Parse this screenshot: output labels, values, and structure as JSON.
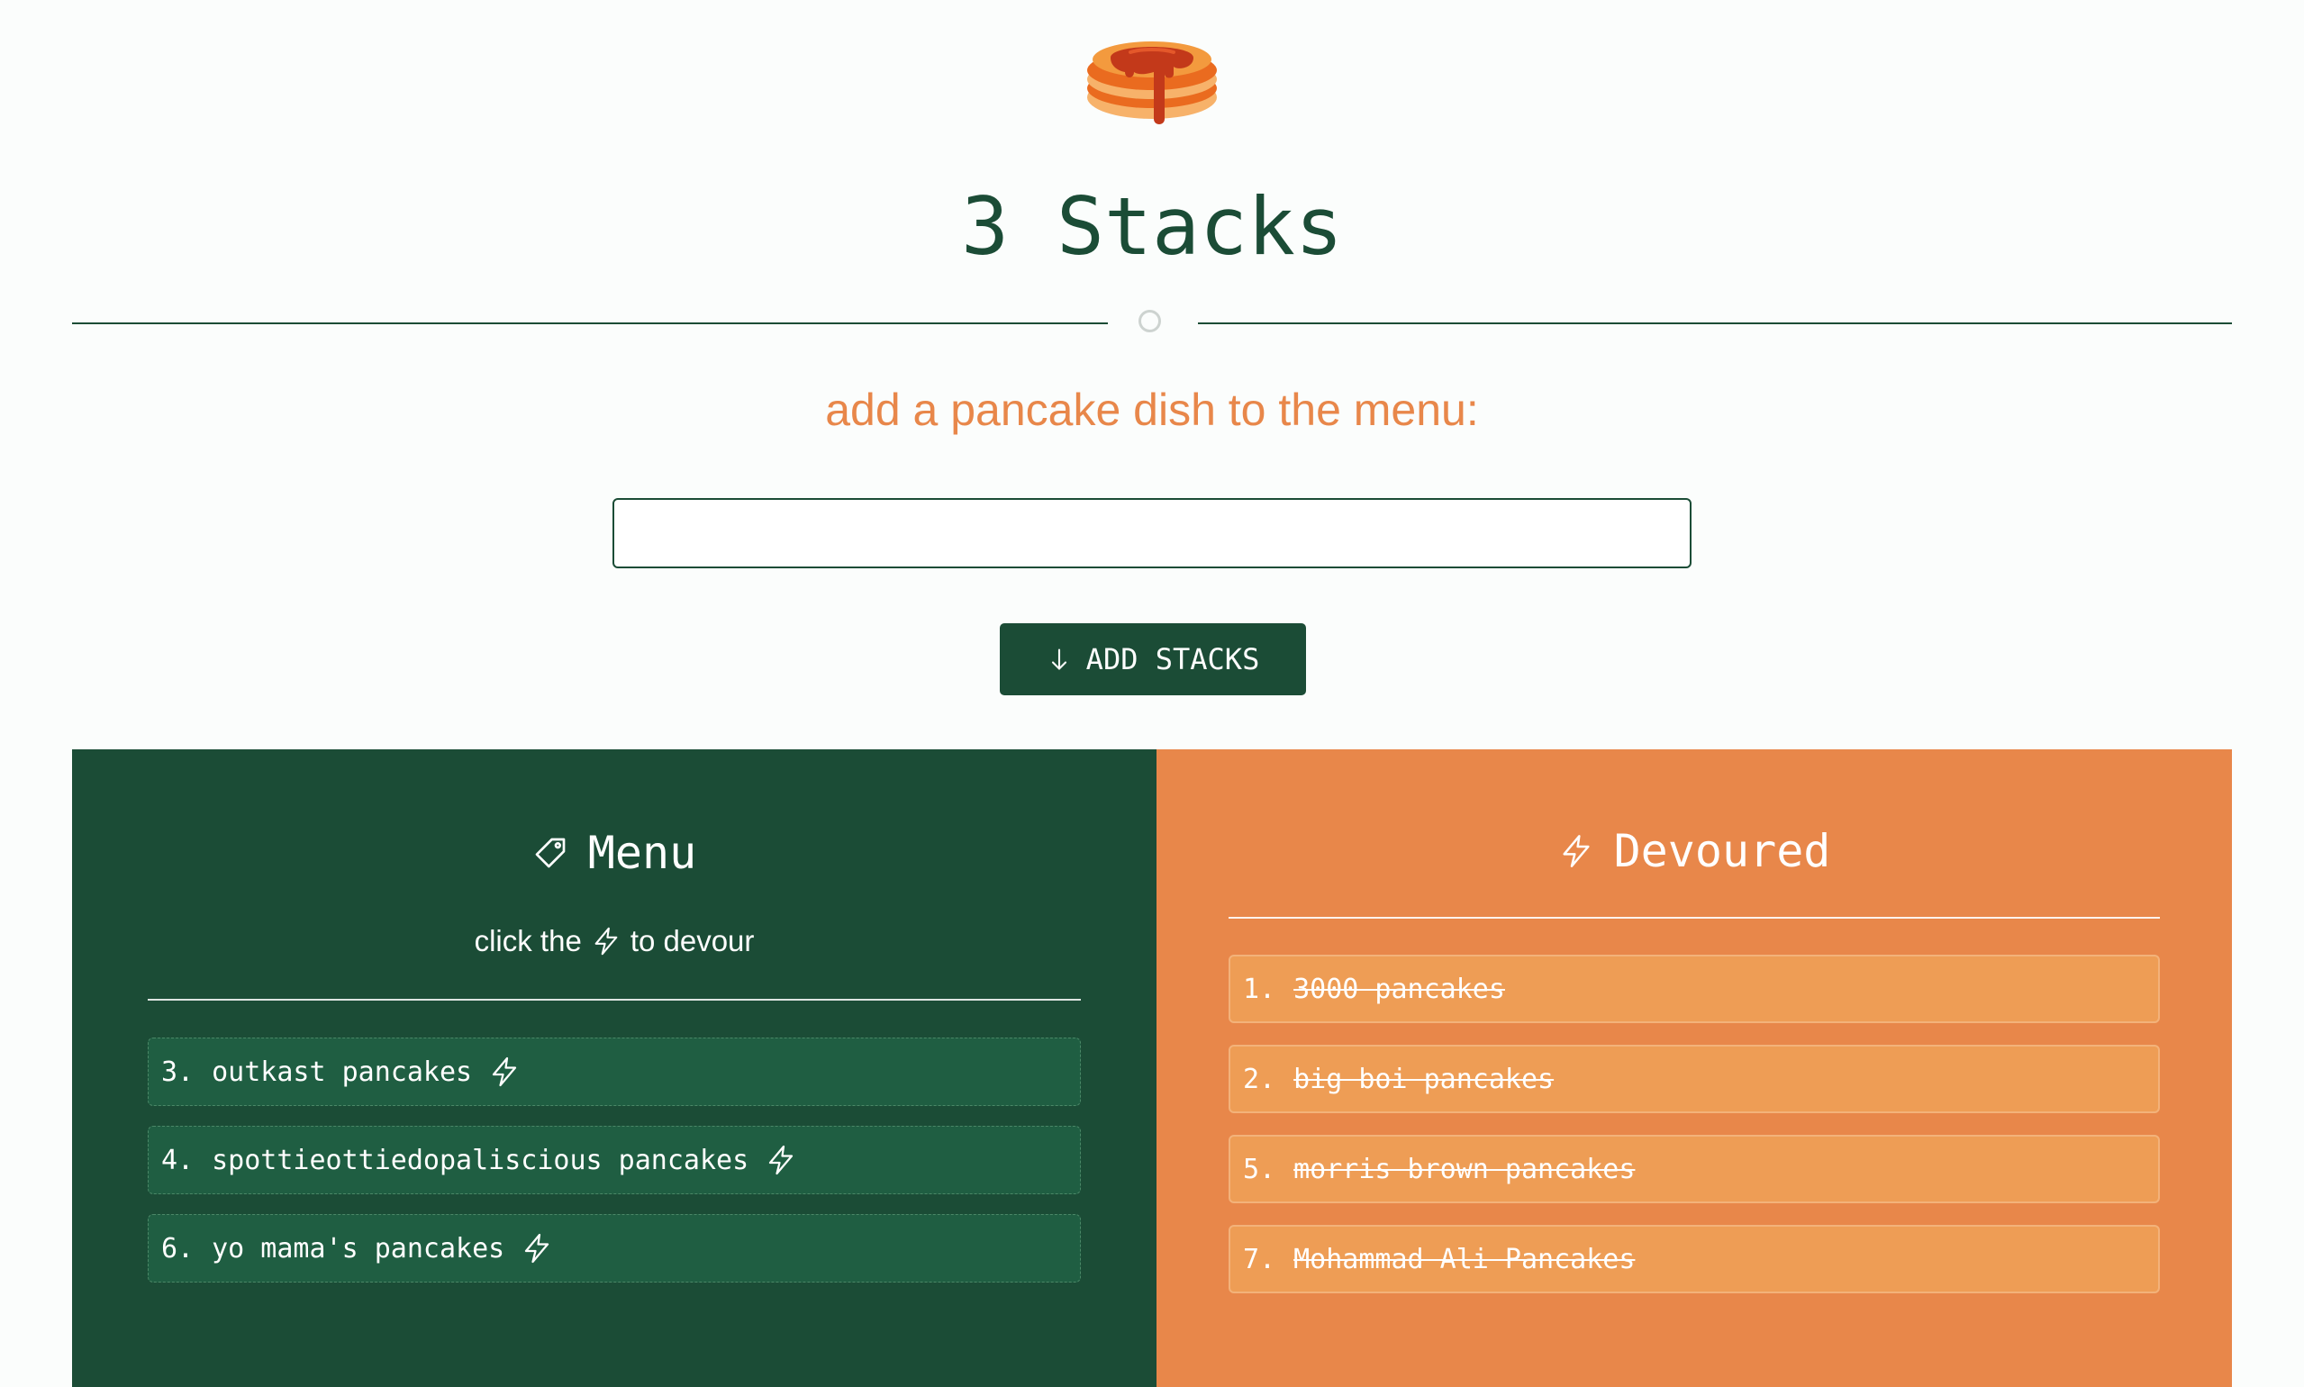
{
  "app": {
    "title": "3 Stacks",
    "logo_icon": "pancake-stack-icon"
  },
  "form": {
    "prompt": "add a pancake dish to the menu:",
    "input_value": "",
    "input_placeholder": "",
    "submit_label": "ADD STACKS",
    "submit_icon": "arrow-down-icon"
  },
  "menu": {
    "heading": "Menu",
    "heading_icon": "tag-icon",
    "hint_before": "click the",
    "hint_after": "to devour",
    "hint_icon": "lightning-icon",
    "items": [
      {
        "number": "3.",
        "name": "outkast pancakes"
      },
      {
        "number": "4.",
        "name": "spottieottiedopaliscious pancakes"
      },
      {
        "number": "6.",
        "name": "yo mama's pancakes"
      }
    ]
  },
  "devoured": {
    "heading": "Devoured",
    "heading_icon": "lightning-icon",
    "items": [
      {
        "number": "1.",
        "name": "3000 pancakes"
      },
      {
        "number": "2.",
        "name": "big boi pancakes"
      },
      {
        "number": "5.",
        "name": "morris brown pancakes"
      },
      {
        "number": "7.",
        "name": "Mohammad Ali Pancakes"
      }
    ]
  },
  "colors": {
    "primary_green": "#1b4c36",
    "accent_orange": "#e8874a",
    "background": "#fbfdfc"
  }
}
